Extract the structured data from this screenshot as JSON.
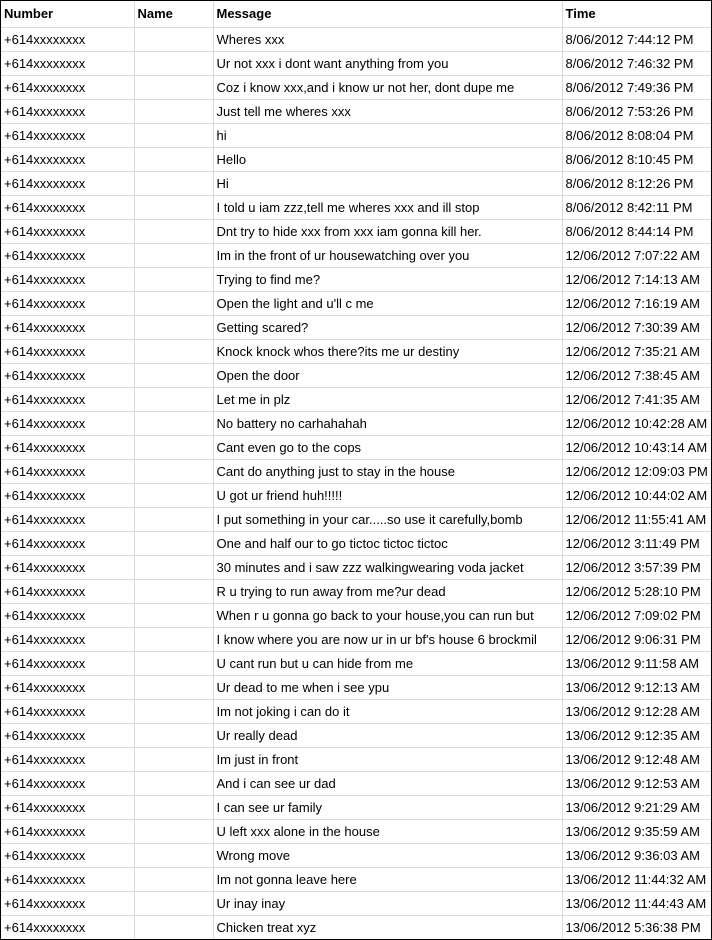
{
  "headers": {
    "number": "Number",
    "name": "Name",
    "message": "Message",
    "time": "Time"
  },
  "rows": [
    {
      "number": "+614xxxxxxxx",
      "name": "",
      "message": "Wheres xxx",
      "time": "8/06/2012 7:44:12 PM"
    },
    {
      "number": "+614xxxxxxxx",
      "name": "",
      "message": "Ur not xxx i dont want anything from you",
      "time": "8/06/2012 7:46:32 PM"
    },
    {
      "number": "+614xxxxxxxx",
      "name": "",
      "message": "Coz i know xxx,and i know ur not her, dont dupe me",
      "time": "8/06/2012 7:49:36 PM"
    },
    {
      "number": "+614xxxxxxxx",
      "name": "",
      "message": "Just tell me wheres xxx",
      "time": "8/06/2012 7:53:26 PM"
    },
    {
      "number": "+614xxxxxxxx",
      "name": "",
      "message": "hi",
      "time": "8/06/2012 8:08:04 PM"
    },
    {
      "number": "+614xxxxxxxx",
      "name": "",
      "message": "Hello",
      "time": "8/06/2012 8:10:45 PM"
    },
    {
      "number": "+614xxxxxxxx",
      "name": "",
      "message": "Hi",
      "time": "8/06/2012 8:12:26 PM"
    },
    {
      "number": "+614xxxxxxxx",
      "name": "",
      "message": "I told u iam zzz,tell  me wheres xxx and ill stop",
      "time": "8/06/2012 8:42:11 PM"
    },
    {
      "number": "+614xxxxxxxx",
      "name": "",
      "message": "Dnt try to hide xxx from xxx iam gonna kill her.",
      "time": "8/06/2012 8:44:14 PM"
    },
    {
      "number": "+614xxxxxxxx",
      "name": "",
      "message": "Im in the front of ur housewatching over you",
      "time": "12/06/2012 7:07:22 AM"
    },
    {
      "number": "+614xxxxxxxx",
      "name": "",
      "message": "Trying to find me?",
      "time": "12/06/2012 7:14:13 AM"
    },
    {
      "number": "+614xxxxxxxx",
      "name": "",
      "message": "Open the light and u'll c me",
      "time": "12/06/2012 7:16:19 AM"
    },
    {
      "number": "+614xxxxxxxx",
      "name": "",
      "message": "Getting scared?",
      "time": "12/06/2012 7:30:39 AM"
    },
    {
      "number": "+614xxxxxxxx",
      "name": "",
      "message": "Knock knock whos there?its me ur destiny",
      "time": "12/06/2012 7:35:21 AM"
    },
    {
      "number": "+614xxxxxxxx",
      "name": "",
      "message": "Open the door",
      "time": "12/06/2012 7:38:45 AM"
    },
    {
      "number": "+614xxxxxxxx",
      "name": "",
      "message": "Let me in plz",
      "time": "12/06/2012 7:41:35 AM"
    },
    {
      "number": "+614xxxxxxxx",
      "name": "",
      "message": "No battery no carhahahah",
      "time": "12/06/2012 10:42:28 AM"
    },
    {
      "number": "+614xxxxxxxx",
      "name": "",
      "message": "Cant even go to the cops",
      "time": "12/06/2012 10:43:14 AM"
    },
    {
      "number": "+614xxxxxxxx",
      "name": "",
      "message": "Cant do anything just to stay in the house",
      "time": "12/06/2012 12:09:03 PM"
    },
    {
      "number": "+614xxxxxxxx",
      "name": "",
      "message": "U got ur friend huh!!!!!",
      "time": "12/06/2012 10:44:02 AM"
    },
    {
      "number": "+614xxxxxxxx",
      "name": "",
      "message": "I put something in your car.....so use it carefully,bomb",
      "time": "12/06/2012 11:55:41 AM"
    },
    {
      "number": "+614xxxxxxxx",
      "name": "",
      "message": "One and half our to go tictoc tictoc tictoc",
      "time": "12/06/2012 3:11:49 PM"
    },
    {
      "number": "+614xxxxxxxx",
      "name": "",
      "message": "30 minutes and i saw zzz walkingwearing voda jacket",
      "time": "12/06/2012 3:57:39 PM"
    },
    {
      "number": "+614xxxxxxxx",
      "name": "",
      "message": "R u trying to run away from me?ur dead",
      "time": "12/06/2012 5:28:10 PM"
    },
    {
      "number": "+614xxxxxxxx",
      "name": "",
      "message": "When r u gonna go back to your house,you can run but",
      "time": "12/06/2012 7:09:02 PM"
    },
    {
      "number": "+614xxxxxxxx",
      "name": "",
      "message": "I know where you are now ur in ur bf's house 6 brockmil",
      "time": "12/06/2012 9:06:31 PM"
    },
    {
      "number": "+614xxxxxxxx",
      "name": "",
      "message": "U cant run but u can hide from me",
      "time": "13/06/2012 9:11:58 AM"
    },
    {
      "number": "+614xxxxxxxx",
      "name": "",
      "message": "Ur dead to me when i see ypu",
      "time": "13/06/2012 9:12:13 AM"
    },
    {
      "number": "+614xxxxxxxx",
      "name": "",
      "message": "Im not joking i can do it",
      "time": "13/06/2012 9:12:28 AM"
    },
    {
      "number": "+614xxxxxxxx",
      "name": "",
      "message": "Ur really dead",
      "time": "13/06/2012 9:12:35 AM"
    },
    {
      "number": "+614xxxxxxxx",
      "name": "",
      "message": "Im just in front",
      "time": "13/06/2012 9:12:48 AM"
    },
    {
      "number": "+614xxxxxxxx",
      "name": "",
      "message": "And i can see ur dad",
      "time": "13/06/2012 9:12:53 AM"
    },
    {
      "number": "+614xxxxxxxx",
      "name": "",
      "message": "I can see ur family",
      "time": "13/06/2012 9:21:29 AM"
    },
    {
      "number": "+614xxxxxxxx",
      "name": "",
      "message": "U left xxx alone in the house",
      "time": "13/06/2012 9:35:59 AM"
    },
    {
      "number": "+614xxxxxxxx",
      "name": "",
      "message": "Wrong move",
      "time": "13/06/2012 9:36:03 AM"
    },
    {
      "number": "+614xxxxxxxx",
      "name": "",
      "message": "Im not gonna leave here",
      "time": "13/06/2012 11:44:32 AM"
    },
    {
      "number": "+614xxxxxxxx",
      "name": "",
      "message": "Ur inay inay",
      "time": "13/06/2012 11:44:43 AM"
    },
    {
      "number": "+614xxxxxxxx",
      "name": "",
      "message": "Chicken treat xyz",
      "time": "13/06/2012 5:36:38 PM"
    }
  ]
}
